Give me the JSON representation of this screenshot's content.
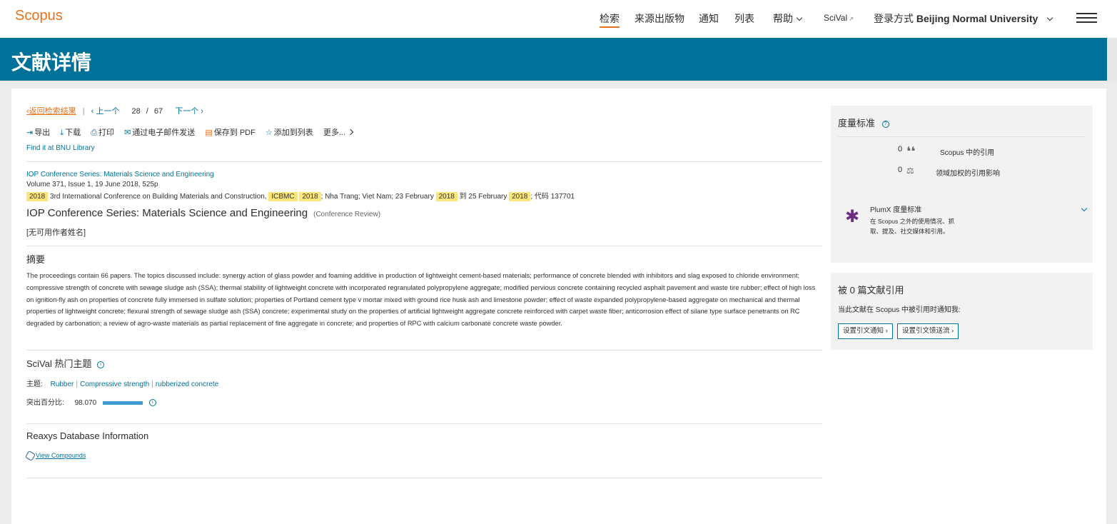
{
  "header": {
    "logo": "Scopus",
    "nav": [
      "检索",
      "来源出版物",
      "通知",
      "列表"
    ],
    "help": "帮助",
    "scival": "SciVal",
    "scival_ext": "↗",
    "login_prefix": "登录方式",
    "institution": "Beijing Normal University"
  },
  "banner": {
    "title": "文献详情"
  },
  "pager": {
    "back": "返回检索结果",
    "prev": "上一个",
    "current": "28",
    "slash": "/",
    "total": "67",
    "next": "下一个"
  },
  "toolbar": {
    "export": "导出",
    "download": "下载",
    "print": "打印",
    "email": "通过电子邮件发送",
    "save_pdf": "保存到 PDF",
    "add_list": "添加到列表",
    "more": "更多..."
  },
  "findit": "Find it at BNU Library",
  "document": {
    "source": "IOP Conference Series: Materials Science and Engineering",
    "volume": "Volume 371, Issue 1, 19 June 2018, 525p",
    "conf_year": "2018",
    "conf_name": "3rd International Conference on Building Materials and Construction,",
    "conf_abbr": "ICBMC",
    "conf_year2": "2018",
    "conf_loc": "; Nha Trang; Viet Nam; 23 February",
    "conf_year3": "2018",
    "conf_to": "到 25 February",
    "conf_year4": "2018",
    "conf_code": "; 代码 137701",
    "title": "IOP Conference Series: Materials Science and Engineering",
    "type": "(Conference Review)",
    "authors": "[无可用作者姓名]"
  },
  "abstract": {
    "heading": "摘要",
    "text": "The proceedings contain 66 papers. The topics discussed include: synergy action of glass powder and foaming additive in production of lightweight cement-based materials; performance of concrete blended with inhibitors and slag exposed to chloride environment; compressive strength of concrete with sewage sludge ash (SSA); thermal stability of lightweight concrete with incorporated regranulated polypropylene aggregate; modified pervious concrete containing recycled asphalt pavement and waste tire rubber; effect of high loss on ignition-fly ash on properties of concrete fully immersed in sulfate solution; properties of Portland cement type v mortar mixed with ground rice husk ash and limestone powder; effect of waste expanded polypropylene-based aggregate on mechanical and thermal properties of lightweight concrete; flexural strength of sewage sludge ash (SSA) concrete; experimental study on the properties of artificial lightweight aggregate concrete reinforced with carpet waste fiber; anticorrosion effect of silane type surface penetrants on RC degraded by carbonation; a review of agro-waste materials as partial replacement of fine aggregate in concrete; and properties of RPC with calcium carbonate concrete waste powder."
  },
  "scival_topics": {
    "heading": "SciVal 热门主题",
    "topic_label": "主题:",
    "topics": [
      "Rubber",
      "Compressive strength",
      "rubberized concrete"
    ],
    "prominence_label": "突出百分比:",
    "prominence_value": "98.070",
    "prominence_fraction": 0.9807
  },
  "reaxys": {
    "heading": "Reaxys Database Information",
    "link": "View Compounds"
  },
  "metrics": {
    "heading": "度量标准",
    "citations_value": "0",
    "citations_label": "Scopus 中的引用",
    "fwci_value": "0",
    "fwci_label": "领域加权的引用影响",
    "plumx_title": "PlumX 度量标准",
    "plumx_desc": "在 Scopus 之外的使用情况、抓取、提及、社交媒体和引用。"
  },
  "cited_by": {
    "heading": "被 0 篇文献引用",
    "notify": "当此文献在 Scopus 中被引用时通知我:",
    "btn_alert": "设置引文通知",
    "btn_feed": "设置引文馈送流"
  },
  "colors": {
    "brand_orange": "#e9711c",
    "banner_blue": "#00729a",
    "link_blue": "#007398",
    "highlight": "#fce57a"
  }
}
